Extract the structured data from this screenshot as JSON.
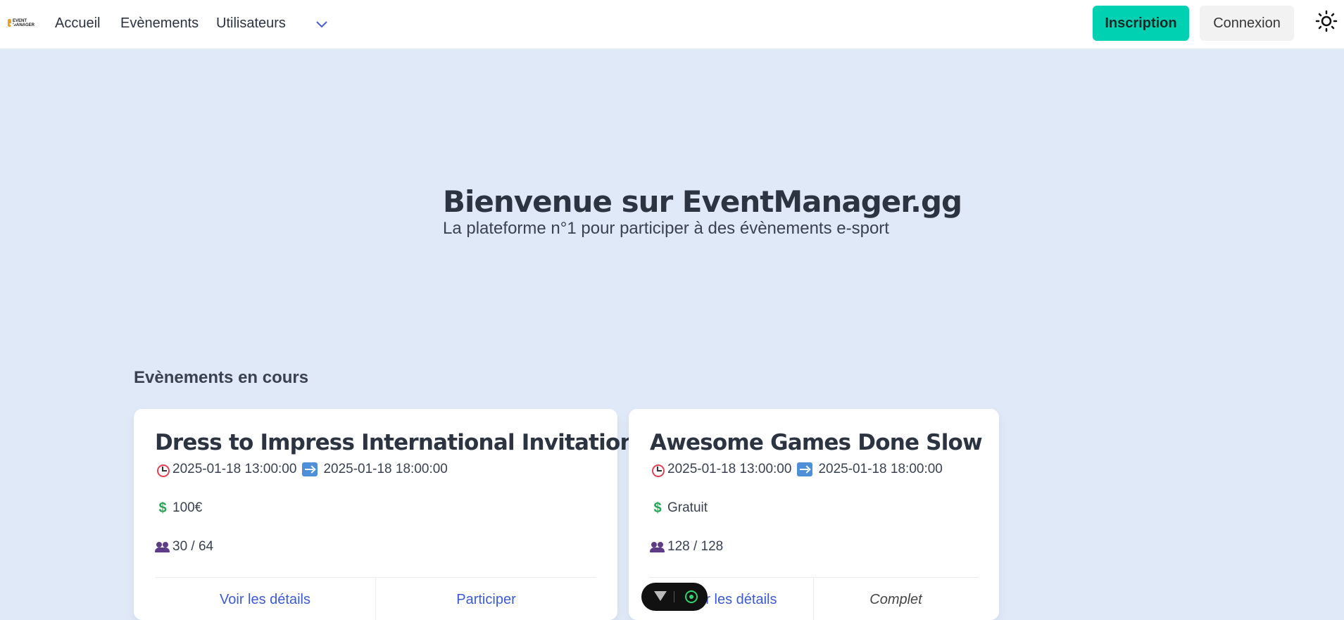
{
  "nav": {
    "logo_text": "EVENT MANAGER",
    "links": [
      "Accueil",
      "Evènements",
      "Utilisateurs"
    ],
    "register_label": "Inscription",
    "login_label": "Connexion",
    "accent_color": "#00d1b2"
  },
  "hero": {
    "title": "Bienvenue sur EventManager.gg",
    "subtitle": "La plateforme n°1 pour participer à des évènements e-sport"
  },
  "section": {
    "title": "Evènements en cours"
  },
  "events": [
    {
      "title": "Dress to Impress International Invitational",
      "start": "2025-01-18 13:00:00",
      "end": "2025-01-18 18:00:00",
      "price": "100€",
      "participants": "30 / 64",
      "details_label": "Voir les détails",
      "action_label": "Participer"
    },
    {
      "title": "Awesome Games Done Slow",
      "start": "2025-01-18 13:00:00",
      "end": "2025-01-18 18:00:00",
      "price": "Gratuit",
      "participants": "128 / 128",
      "details_label": "Voir les détails",
      "action_label": "Complet"
    }
  ]
}
